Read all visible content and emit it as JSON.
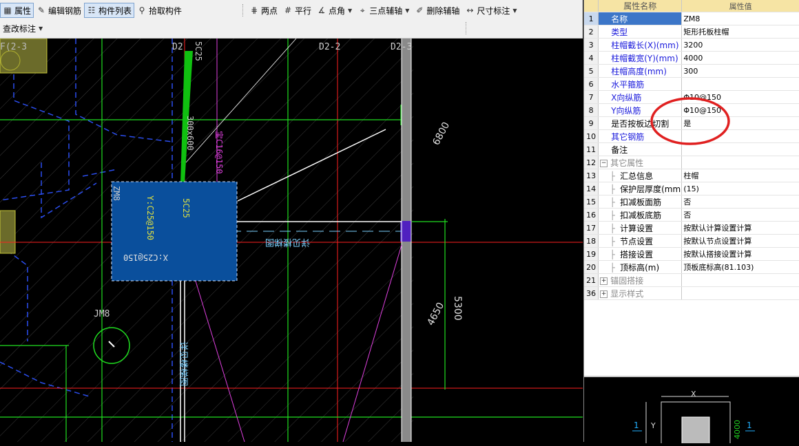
{
  "toolbar": {
    "row1": [
      {
        "label": "属性",
        "icon": "property-icon",
        "active": true
      },
      {
        "label": "编辑钢筋",
        "icon": "edit-rebar-icon",
        "active": false
      },
      {
        "label": "构件列表",
        "icon": "component-list-icon",
        "active": true
      },
      {
        "label": "拾取构件",
        "icon": "pick-component-icon",
        "active": false
      }
    ],
    "row1b": [
      {
        "label": "两点",
        "icon": "two-point-icon",
        "dropdown": false
      },
      {
        "label": "平行",
        "icon": "parallel-icon",
        "dropdown": false
      },
      {
        "label": "点角",
        "icon": "point-angle-icon",
        "dropdown": true
      },
      {
        "label": "三点辅轴",
        "icon": "three-point-axis-icon",
        "dropdown": true
      },
      {
        "label": "删除辅轴",
        "icon": "delete-axis-icon",
        "dropdown": false
      },
      {
        "label": "尺寸标注",
        "icon": "dimension-icon",
        "dropdown": true
      }
    ],
    "row2": [
      {
        "label": "查改标注",
        "dropdown": true
      }
    ]
  },
  "canvas": {
    "labels": {
      "axis_d2_left": "D2",
      "axis_d2_2": "D2-2",
      "axis_d2_3": "D2-3",
      "axis_top_left": "F(2-3",
      "rebar_5c25_top": "5C25",
      "beam_size": "300x600",
      "rebar_magenta": "宝C16@150",
      "zm8": "ZM8",
      "cap_y": "Y:C25@150",
      "cap_x": "X:C25@150",
      "rebar_5c25_mid": "5C25",
      "detail_ref": "详见楼梯图",
      "detail_ref2": "详见楼梯图",
      "jm8": "JM8",
      "dim_6800": "6800",
      "dim_4650": "4650",
      "dim_5300": "5300"
    }
  },
  "properties": {
    "headers": [
      "属性名称",
      "属性值"
    ],
    "rows": [
      {
        "no": "1",
        "name": "名称",
        "value": "ZM8",
        "style": "blue",
        "selected": true
      },
      {
        "no": "2",
        "name": "类型",
        "value": "矩形托板柱帽",
        "style": "blue"
      },
      {
        "no": "3",
        "name": "柱帽截长(X)(mm)",
        "value": "3200",
        "style": "blue"
      },
      {
        "no": "4",
        "name": "柱帽截宽(Y)(mm)",
        "value": "4000",
        "style": "blue"
      },
      {
        "no": "5",
        "name": "柱帽高度(mm)",
        "value": "300",
        "style": "blue"
      },
      {
        "no": "6",
        "name": "水平箍筋",
        "value": "",
        "style": "blue"
      },
      {
        "no": "7",
        "name": "X向纵筋",
        "value": "Φ10@150",
        "style": "blue"
      },
      {
        "no": "8",
        "name": "Y向纵筋",
        "value": "Φ10@150",
        "style": "blue"
      },
      {
        "no": "9",
        "name": "是否按板边切割",
        "value": "是",
        "style": "black"
      },
      {
        "no": "10",
        "name": "其它钢筋",
        "value": "",
        "style": "blue"
      },
      {
        "no": "11",
        "name": "备注",
        "value": "",
        "style": "black"
      },
      {
        "no": "12",
        "name": "其它属性",
        "value": "",
        "style": "group-open"
      },
      {
        "no": "13",
        "name": "汇总信息",
        "value": "柱帽",
        "style": "child"
      },
      {
        "no": "14",
        "name": "保护层厚度(mm)",
        "value": "(15)",
        "style": "child"
      },
      {
        "no": "15",
        "name": "扣减板面筋",
        "value": "否",
        "style": "child"
      },
      {
        "no": "16",
        "name": "扣减板底筋",
        "value": "否",
        "style": "child"
      },
      {
        "no": "17",
        "name": "计算设置",
        "value": "按默认计算设置计算",
        "style": "child"
      },
      {
        "no": "18",
        "name": "节点设置",
        "value": "按默认节点设置计算",
        "style": "child"
      },
      {
        "no": "19",
        "name": "搭接设置",
        "value": "按默认搭接设置计算",
        "style": "child"
      },
      {
        "no": "20",
        "name": "顶标高(m)",
        "value": "顶板底标高(81.103)",
        "style": "child"
      },
      {
        "no": "21",
        "name": "锚固搭接",
        "value": "",
        "style": "group-closed"
      },
      {
        "no": "36",
        "name": "显示样式",
        "value": "",
        "style": "group-closed"
      }
    ]
  },
  "preview": {
    "x_label": "X",
    "y_label": "Y",
    "dim_4000": "4000",
    "section_left": "1",
    "section_right": "1"
  },
  "colors": {
    "highlight_circle": "#e02020",
    "column_cap_fill": "#0a4f9c",
    "grid_red": "#ff0000",
    "grid_green": "#00d000"
  }
}
